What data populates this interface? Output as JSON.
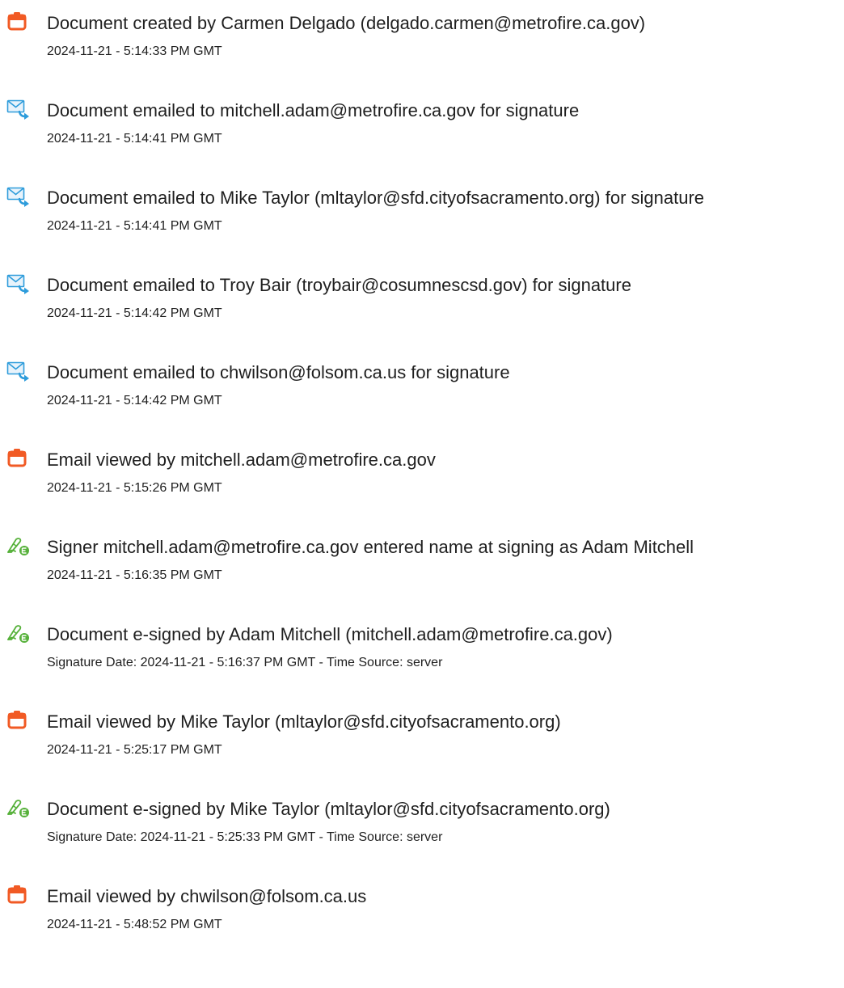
{
  "audit_events": [
    {
      "icon": "document-icon",
      "title": "Document created by Carmen Delgado (delgado.carmen@metrofire.ca.gov)",
      "stamp": "2024-11-21 - 5:14:33 PM GMT"
    },
    {
      "icon": "email-sent-icon",
      "title": "Document emailed to mitchell.adam@metrofire.ca.gov for signature",
      "stamp": "2024-11-21 - 5:14:41 PM GMT"
    },
    {
      "icon": "email-sent-icon",
      "title": "Document emailed to Mike Taylor (mltaylor@sfd.cityofsacramento.org) for signature",
      "stamp": "2024-11-21 - 5:14:41 PM GMT"
    },
    {
      "icon": "email-sent-icon",
      "title": "Document emailed to Troy Bair (troybair@cosumnescsd.gov) for signature",
      "stamp": "2024-11-21 - 5:14:42 PM GMT"
    },
    {
      "icon": "email-sent-icon",
      "title": "Document emailed to chwilson@folsom.ca.us for signature",
      "stamp": "2024-11-21 - 5:14:42 PM GMT"
    },
    {
      "icon": "document-icon",
      "title": "Email viewed by mitchell.adam@metrofire.ca.gov",
      "stamp": "2024-11-21 - 5:15:26 PM GMT"
    },
    {
      "icon": "e-sign-pen-icon",
      "title": "Signer mitchell.adam@metrofire.ca.gov entered name at signing as Adam Mitchell",
      "stamp": "2024-11-21 - 5:16:35 PM GMT"
    },
    {
      "icon": "e-sign-pen-icon",
      "title": "Document e-signed by Adam Mitchell (mitchell.adam@metrofire.ca.gov)",
      "stamp": "Signature Date: 2024-11-21 - 5:16:37 PM GMT - Time Source: server"
    },
    {
      "icon": "document-icon",
      "title": "Email viewed by Mike Taylor (mltaylor@sfd.cityofsacramento.org)",
      "stamp": "2024-11-21 - 5:25:17 PM GMT"
    },
    {
      "icon": "e-sign-pen-icon",
      "title": "Document e-signed by Mike Taylor (mltaylor@sfd.cityofsacramento.org)",
      "stamp": "Signature Date: 2024-11-21 - 5:25:33 PM GMT - Time Source: server"
    },
    {
      "icon": "document-icon",
      "title": "Email viewed by chwilson@folsom.ca.us",
      "stamp": "2024-11-21 - 5:48:52 PM GMT"
    }
  ],
  "colors": {
    "document_icon": "#f15a24",
    "email_icon": "#2d9cdb",
    "email_icon_fill": "#e8f3fb",
    "sign_icon": "#56b13a",
    "text": "#1f1f1f"
  }
}
